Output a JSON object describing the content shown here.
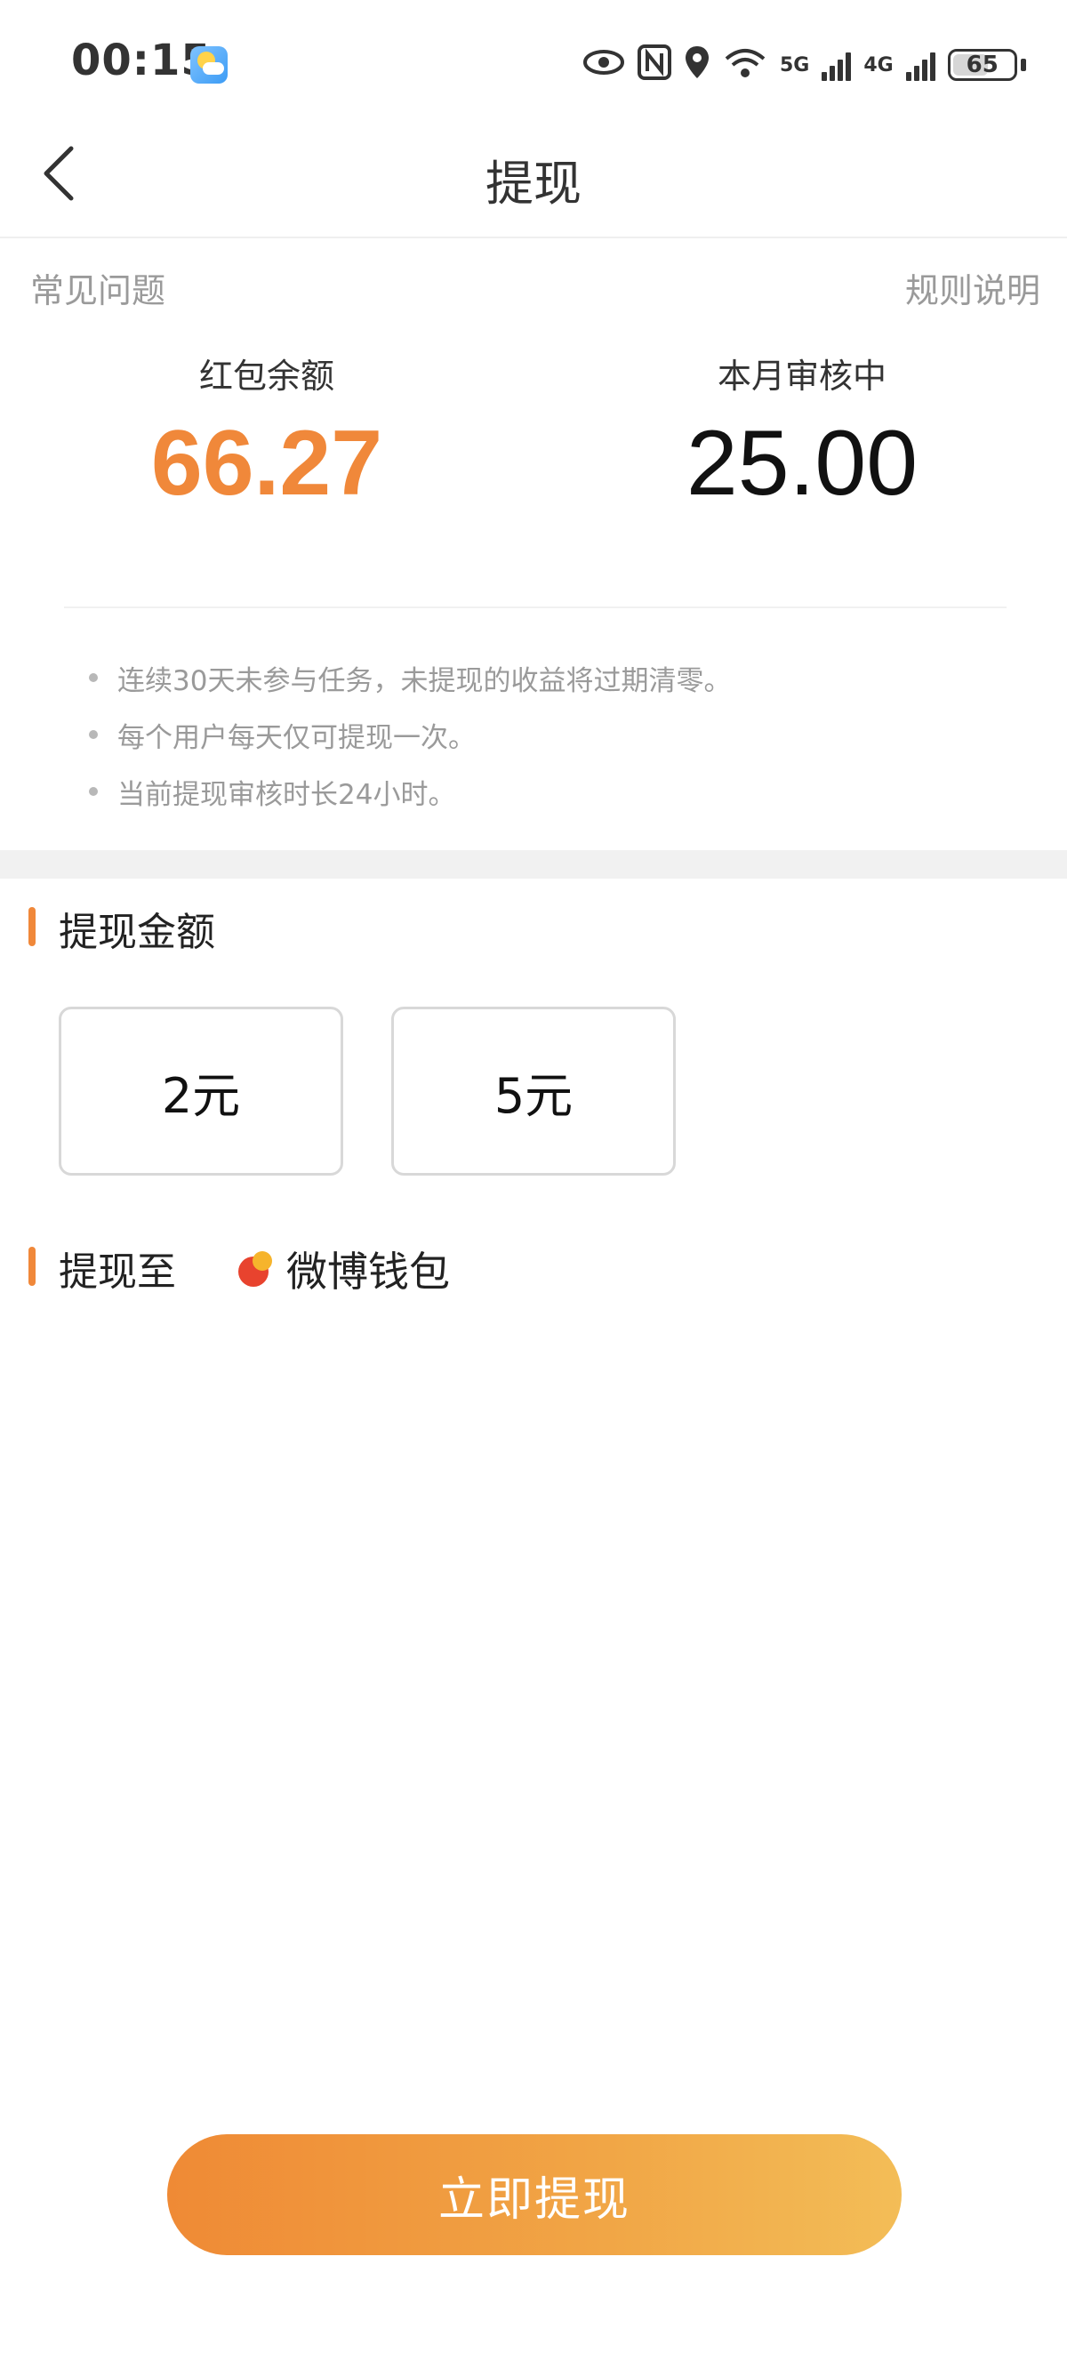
{
  "status_bar": {
    "time": "00:15",
    "net_5g": "5G",
    "net_4g": "4G",
    "battery": "65"
  },
  "header": {
    "title": "提现"
  },
  "links": {
    "faq": "常见问题",
    "rules": "规则说明"
  },
  "balances": {
    "red_packet_label": "红包余额",
    "red_packet_value": "66.27",
    "reviewing_label": "本月审核中",
    "reviewing_value": "25.00"
  },
  "notes": [
    "连续30天未参与任务，未提现的收益将过期清零。",
    "每个用户每天仅可提现一次。",
    "当前提现审核时长24小时。"
  ],
  "amount_section": {
    "title": "提现金额",
    "options": [
      "2元",
      "5元"
    ]
  },
  "destination": {
    "title": "提现至",
    "wallet": "微博钱包"
  },
  "submit_label": "立即提现",
  "colors": {
    "accent": "#f0883a",
    "muted": "#9a9a9a"
  }
}
